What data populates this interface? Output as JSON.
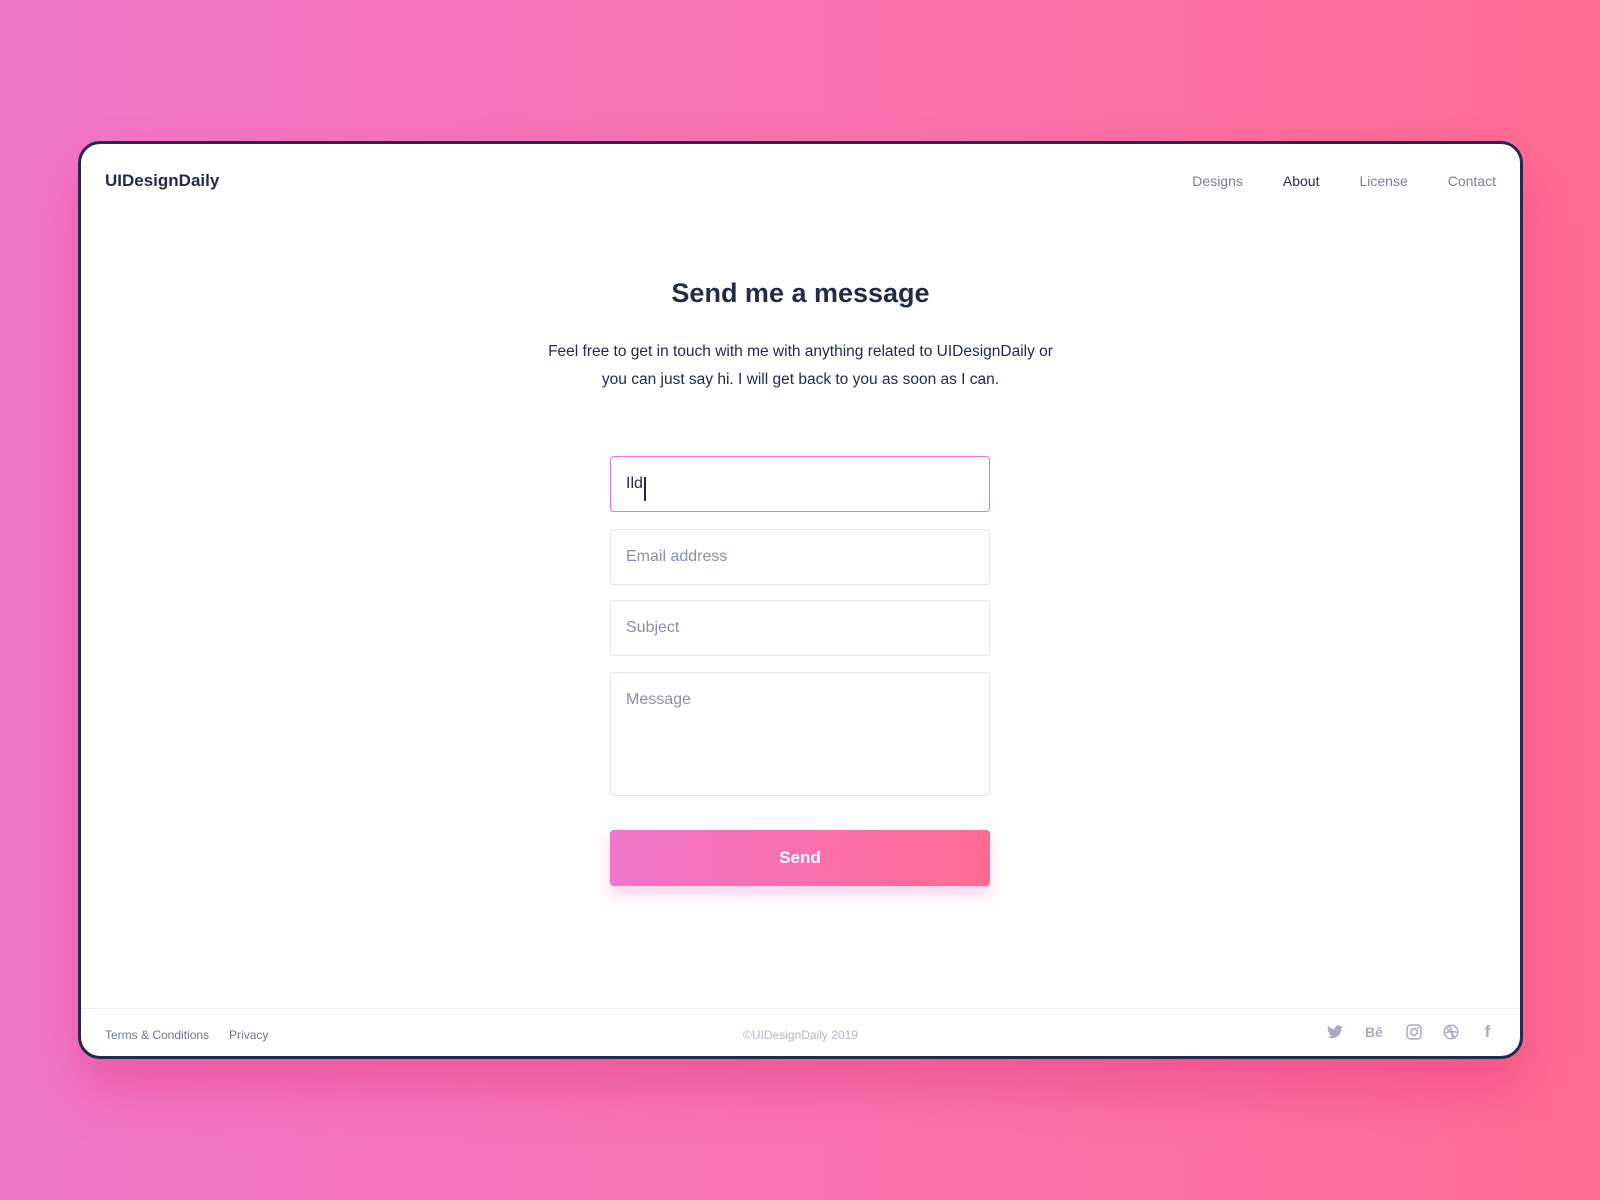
{
  "header": {
    "logo": "UIDesignDaily",
    "nav": [
      {
        "label": "Designs"
      },
      {
        "label": "About"
      },
      {
        "label": "License"
      },
      {
        "label": "Contact"
      }
    ],
    "active": "About"
  },
  "main": {
    "title": "Send me a message",
    "description_line1": "Feel free to get in touch with me with anything related to UIDesignDaily or",
    "description_line2": "you can just say hi. I will get back to you as soon as I can.",
    "form": {
      "name_value": "Ild",
      "email_placeholder": "Email address",
      "subject_placeholder": "Subject",
      "message_placeholder": "Message",
      "send_label": "Send"
    }
  },
  "footer": {
    "links": [
      {
        "label": "Terms & Conditions"
      },
      {
        "label": "Privacy"
      }
    ],
    "copyright": "©UIDesignDaily 2019",
    "social_icons": [
      "twitter-icon",
      "behance-icon",
      "instagram-icon",
      "dribbble-icon",
      "facebook-icon"
    ],
    "behance_text": "Bē",
    "facebook_text": "f"
  },
  "colors": {
    "dark": "#232a4a",
    "gradient_start": "#f076c8",
    "gradient_end": "#ff6a92",
    "focus_border": "#f56fc4"
  }
}
